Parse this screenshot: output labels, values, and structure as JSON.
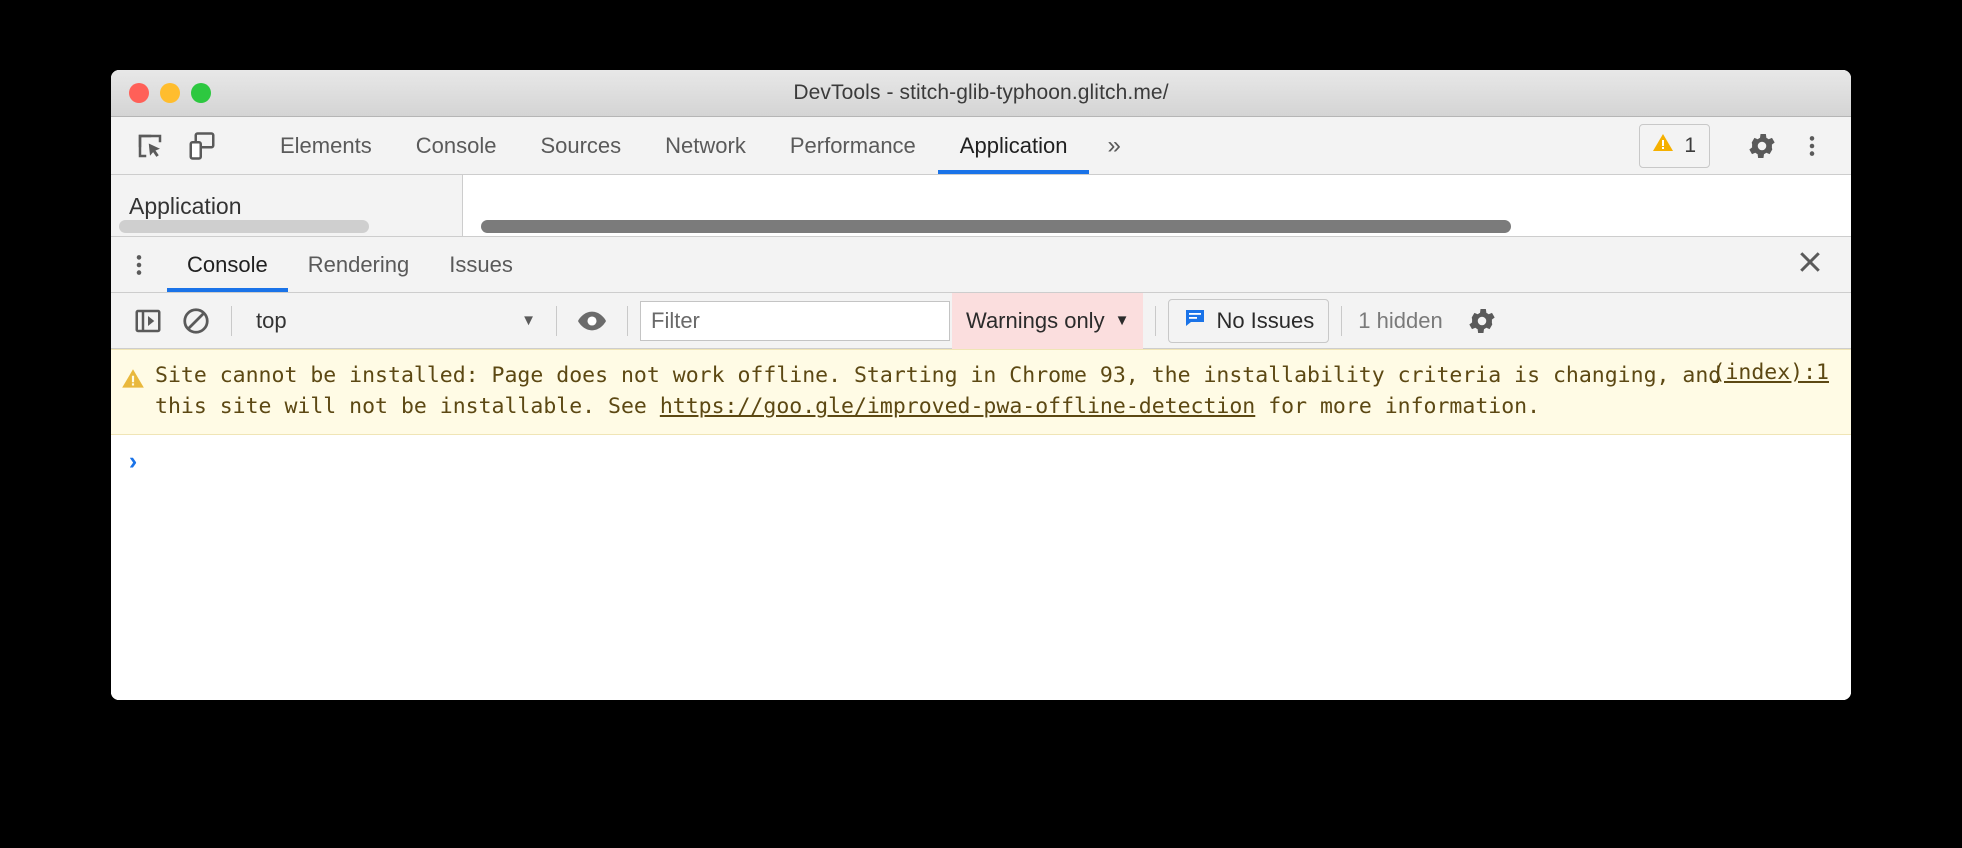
{
  "window": {
    "title": "DevTools - stitch-glib-typhoon.glitch.me/",
    "traffic_lights": [
      "close",
      "minimize",
      "zoom"
    ],
    "colors": {
      "red": "#ff6058",
      "yellow": "#ffbd2e",
      "green": "#2dc840",
      "accent_blue": "#1a73e8",
      "warning_bg": "#fffbe5",
      "warning_text": "#5c4813",
      "level_filter_bg": "#fbdede"
    }
  },
  "toolbar": {
    "inspect_icon": "inspect-element-icon",
    "device_icon": "device-toolbar-icon",
    "tabs": [
      {
        "label": "Elements",
        "active": false
      },
      {
        "label": "Console",
        "active": false
      },
      {
        "label": "Sources",
        "active": false
      },
      {
        "label": "Network",
        "active": false
      },
      {
        "label": "Performance",
        "active": false
      },
      {
        "label": "Application",
        "active": true
      }
    ],
    "more_tabs_label": "»",
    "warning_badge": {
      "icon": "warning-triangle-icon",
      "count": "1"
    },
    "settings_icon": "gear-icon",
    "menu_icon": "kebab-menu-icon"
  },
  "panel_strip": {
    "sidebar_clipped_label": "Application",
    "main_clipped_label": ""
  },
  "drawer": {
    "menu_icon": "kebab-menu-icon",
    "tabs": [
      {
        "label": "Console",
        "active": true
      },
      {
        "label": "Rendering",
        "active": false
      },
      {
        "label": "Issues",
        "active": false
      }
    ],
    "close_icon": "close-icon"
  },
  "console_toolbar": {
    "sidebar_toggle_icon": "console-sidebar-icon",
    "clear_icon": "clear-console-icon",
    "context": {
      "value": "top",
      "caret": "▼"
    },
    "eye_icon": "live-expression-eye-icon",
    "filter": {
      "value": "",
      "placeholder": "Filter"
    },
    "level": {
      "value": "Warnings only",
      "caret": "▼"
    },
    "issues": {
      "icon": "issues-message-icon",
      "label": "No Issues"
    },
    "hidden_count": "1 hidden",
    "settings_icon": "gear-icon"
  },
  "console": {
    "messages": [
      {
        "type": "warning",
        "icon": "warning-triangle-icon",
        "text_before_link": "Site cannot be installed: Page does not work offline. Starting in Chrome 93, the installability criteria is changing, and this site will not be installable. See ",
        "link_text": "https://goo.gle/improved-pwa-offline-detection",
        "text_after_link": " for more information.",
        "source_link": "(index):1"
      }
    ],
    "prompt_caret": "›"
  }
}
